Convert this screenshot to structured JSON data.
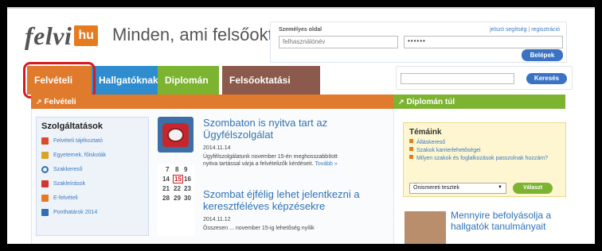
{
  "header": {
    "logo_text": "felvi",
    "logo_tld": "hu",
    "tagline": "Minden, ami felsőoktatás"
  },
  "login": {
    "title": "Személyes oldal",
    "help_link": "jelszó segítség",
    "separator": "|",
    "register_link": "regisztráció",
    "username_placeholder": "felhasználónév",
    "password_value": "••••••",
    "submit_label": "Belépek"
  },
  "tabs": [
    {
      "label": "Felvételi",
      "color": "#e07a2c"
    },
    {
      "label": "Hallgatóknak",
      "color": "#2f8dcf"
    },
    {
      "label": "Diplomán túl",
      "color": "#7cb431"
    },
    {
      "label": "Felsőoktatási műhely",
      "color": "#8b5a4c"
    }
  ],
  "search": {
    "value": "",
    "button_label": "Keresés"
  },
  "felveteli_section": {
    "title": "Felvételi",
    "arrow": "↗",
    "services": {
      "title": "Szolgáltatások",
      "items": [
        {
          "label": "Felvételi tájékoztató",
          "icon": "brochure-icon",
          "color": "#e0482a"
        },
        {
          "label": "Egyetemek, főiskolák",
          "icon": "university-icon",
          "color": "#d9a52b"
        },
        {
          "label": "Szakkereső",
          "icon": "search-icon",
          "color": "#2f6fb5"
        },
        {
          "label": "Szakleírások",
          "icon": "document-icon",
          "color": "#d1372f"
        },
        {
          "label": "E-felvételi",
          "icon": "e-felveteli-icon",
          "color": "#e67a1f"
        },
        {
          "label": "Ponthatárok 2014",
          "icon": "chart-icon",
          "color": "#2f6fb5"
        }
      ]
    },
    "news": [
      {
        "title_line1": "Szombaton is nyitva tart az",
        "title_line2": "Ügyfélszolgálat",
        "date": "2014.11.14",
        "text_line1": "Ügyfélszolgálatunk november 15-én meghosszabbított",
        "text_line2": "nyitva tartással várja a felvételizők kérdéseit.",
        "more": "Tovább »"
      },
      {
        "title_line1": "Szombat éjfélig lehet jelentkezni a",
        "title_line2": "keresztféléves képzésekre",
        "date": "2014.11.12",
        "text_line1": "Összesen ... november 15-ig lehetőség nyílik"
      }
    ],
    "calendar_numbers": [
      "7",
      "8",
      "9",
      "14",
      "15",
      "16",
      "21",
      "22",
      "23",
      "28",
      "29",
      "30"
    ]
  },
  "diploman_section": {
    "title": "Diplomán túl",
    "arrow": "↗",
    "topics": {
      "title": "Témáink",
      "items": [
        "Álláskereső",
        "Szakok karrierlehetőségei",
        "Milyen szakok és foglalkozások passzolnak hozzám?"
      ],
      "select_value": "Önismereti tesztek",
      "button_label": "Választ"
    },
    "promo_line1": "Mennyire befolyásolja a",
    "promo_line2": "hallgatók tanulmányait"
  }
}
